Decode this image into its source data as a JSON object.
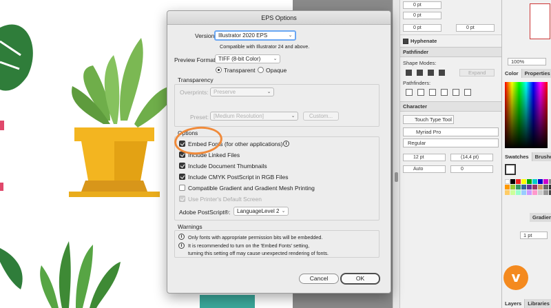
{
  "dialog": {
    "title": "EPS Options",
    "version_label": "Version:",
    "version_value": "Illustrator 2020 EPS",
    "compat_note": "Compatible with Illustrator 24 and above.",
    "preview_label": "Preview Format:",
    "preview_value": "TIFF (8-bit Color)",
    "radio_transparent": "Transparent",
    "radio_opaque": "Opaque",
    "transparency": {
      "legend": "Transparency",
      "overprints_label": "Overprints:",
      "overprints_value": "Preserve",
      "preset_label": "Preset:",
      "preset_value": "[Medium Resolution]",
      "custom_button": "Custom..."
    },
    "options": {
      "legend": "Options",
      "embed_fonts": "Embed Fonts (for other applications)",
      "include_linked": "Include Linked Files",
      "include_thumbnails": "Include Document Thumbnails",
      "include_cmyk": "Include CMYK PostScript in RGB Files",
      "compatible_gradient": "Compatible Gradient and Gradient Mesh Printing",
      "use_printer_default": "Use Printer's Default Screen",
      "postscript_label": "Adobe PostScript®:",
      "postscript_value": "LanguageLevel 2"
    },
    "warnings": {
      "legend": "Warnings",
      "w1": "Only fonts with appropriate permission bits will be embedded.",
      "w2a": "It is recommended to turn on the 'Embed Fonts' setting,",
      "w2b": "turning this setting off may cause unexpected rendering of fonts."
    },
    "cancel": "Cancel",
    "ok": "OK"
  },
  "panel": {
    "spin1": "0 pt",
    "spin2": "0 pt",
    "spin3": "0 pt",
    "spin4": "0 pt",
    "spin5": "0 pt",
    "hyphenate": "Hyphenate",
    "pathfinder_title": "Pathfinder",
    "shape_modes": "Shape Modes:",
    "expand": "Expand",
    "pathfinders": "Pathfinders:",
    "character_title": "Character",
    "touch_type": "Touch Type Tool",
    "font_family": "Myriad Pro",
    "font_style": "Regular",
    "font_size": "12 pt",
    "leading": "(14,4 pt)",
    "kerning": "Auto",
    "tracking": "0"
  },
  "panel2": {
    "zoom": "100%",
    "color_tab": "Color",
    "properties_tab": "Properties",
    "swatches_tab": "Swatches",
    "brushes_tab": "Brushes",
    "gradient_tab": "Gradient",
    "stroke_weight": "1 pt",
    "layers_tab": "Layers",
    "libraries_tab": "Libraries"
  },
  "colors": {
    "annotation": "#f08a3a",
    "pot_yellow": "#f3b520",
    "leaf_green": "#6fae4a",
    "logo_orange": "#f48a1f"
  }
}
